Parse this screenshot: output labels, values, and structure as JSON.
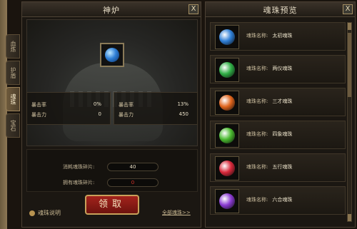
{
  "left_panel": {
    "title": "神炉",
    "close": "X",
    "tabs": [
      "血炼",
      "护盾",
      "魂珠",
      "宝石"
    ],
    "active_tab_index": 2,
    "stats_left": [
      {
        "label": "暴击率",
        "value": "0%"
      },
      {
        "label": "暴击力",
        "value": "0"
      }
    ],
    "stats_right": [
      {
        "label": "暴击率",
        "value": "13%"
      },
      {
        "label": "暴击力",
        "value": "450"
      }
    ],
    "consume_label": "消耗魂珠碎片:",
    "consume_value": "40",
    "owned_label": "拥有魂珠碎片:",
    "owned_value": "0",
    "receive_button": "领取",
    "help_link": "魂珠说明",
    "all_link": "全部魂珠>>"
  },
  "right_panel": {
    "title": "魂珠预览",
    "close": "X",
    "items": [
      {
        "prefix": "魂珠名称:",
        "name": "太初魂珠",
        "color": "#2f7fd6"
      },
      {
        "prefix": "魂珠名称:",
        "name": "两仪魂珠",
        "color": "#2fae45"
      },
      {
        "prefix": "魂珠名称:",
        "name": "三才魂珠",
        "color": "#e0641c"
      },
      {
        "prefix": "魂珠名称:",
        "name": "四象魂珠",
        "color": "#49b92e"
      },
      {
        "prefix": "魂珠名称:",
        "name": "五行魂珠",
        "color": "#d8283a"
      },
      {
        "prefix": "魂珠名称:",
        "name": "六合魂珠",
        "color": "#8a3ad1"
      }
    ]
  }
}
